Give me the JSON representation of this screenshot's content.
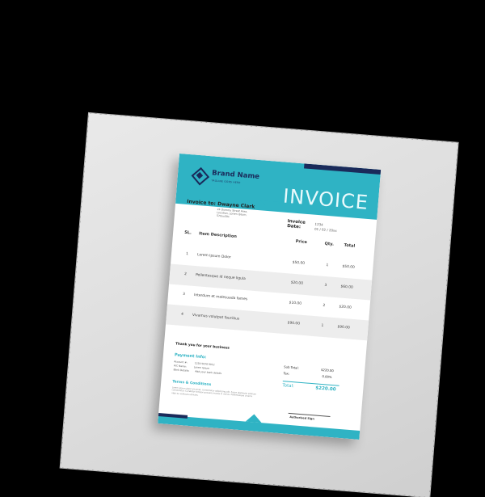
{
  "invoice": {
    "brand_name": "Brand Name",
    "brand_tagline": "TAGLINE GOES HERE",
    "title": "INVOICE",
    "invoice_to_label": "Invoice to:",
    "client_name": "Dwayne Clark",
    "client_address": "24 Dummy Street Area, Location, Lorem Ipsum, 570xx59x",
    "invoice_date_label": "Invoice Date:",
    "invoice_no": "1234",
    "invoice_date": "01 / 02 / 20xx",
    "columns": {
      "sl": "SL.",
      "item": "Item Description",
      "price": "Price",
      "qty": "Qty.",
      "total": "Total"
    },
    "items": [
      {
        "sl": "1",
        "desc": "Lorem Ipsum Dolor",
        "price": "$50.00",
        "qty": "1",
        "total": "$50.00"
      },
      {
        "sl": "2",
        "desc": "Pellentesque id neque ligula",
        "price": "$20.00",
        "qty": "3",
        "total": "$60.00"
      },
      {
        "sl": "3",
        "desc": "Interdum et malesuada fames",
        "price": "$10.00",
        "qty": "2",
        "total": "$20.00"
      },
      {
        "sl": "4",
        "desc": "Vivamus volutpat faucibus",
        "price": "$90.00",
        "qty": "1",
        "total": "$90.00"
      }
    ],
    "thanks": "Thank you for your business",
    "payment_heading": "Payment Info:",
    "payment_account_label": "Account #:",
    "payment_account_value": "1234 5678 9012",
    "payment_name_label": "A/C Name:",
    "payment_name_value": "Lorem Ipsum",
    "payment_bank_label": "Bank Details:",
    "payment_bank_value": "Add your bank details",
    "terms_heading": "Terms & Conditions",
    "terms_text": "Lorem ipsum dolor sit amet, consectetur adipiscing elit. Fusce dignissim pretium consectetur. Curabitur tempor posuere massa in varius. Pellentesque viverra nibh eu vehicula ultricies.",
    "subtotal_label": "Sub Total:",
    "subtotal_value": "$220.00",
    "tax_label": "Tax:",
    "tax_value": "0.00%",
    "total_label": "Total:",
    "total_value": "$220.00",
    "signature": "Authorised Sign"
  },
  "colors": {
    "accent": "#2fb3c4",
    "navy": "#1a2a5a",
    "background": "#000000",
    "mat": "#dcdcdc"
  }
}
